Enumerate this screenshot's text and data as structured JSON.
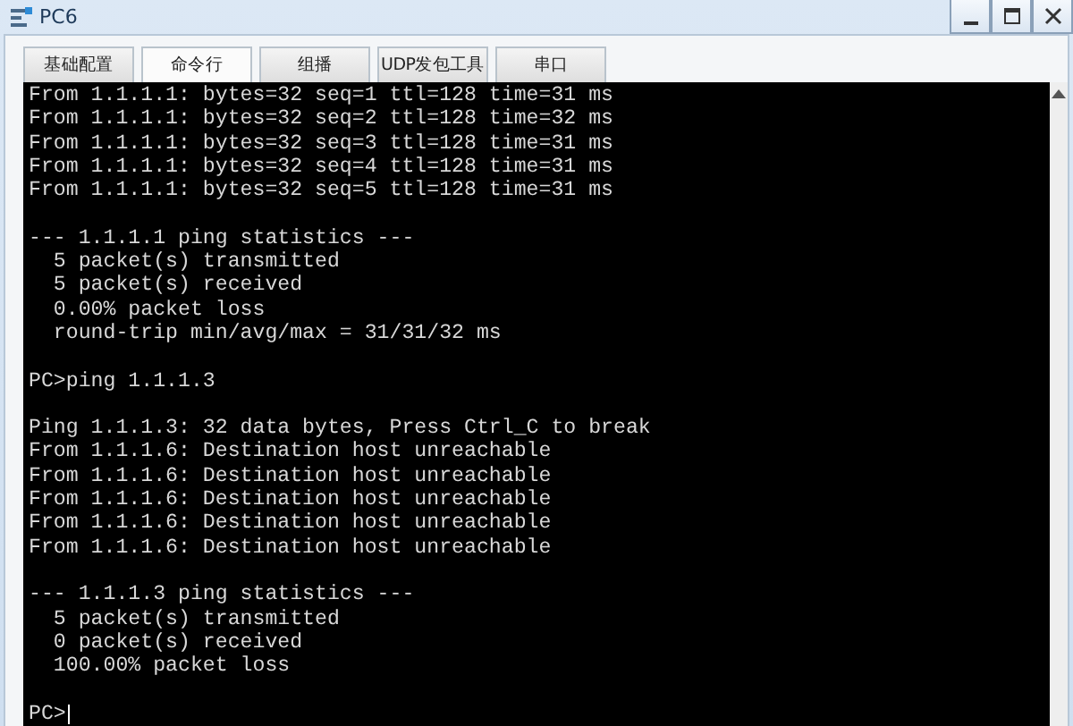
{
  "window": {
    "title": "PC6",
    "controls": [
      {
        "kind": "minimize"
      },
      {
        "kind": "maximize"
      },
      {
        "kind": "close"
      }
    ]
  },
  "tabs": [
    {
      "label": "基础配置",
      "selected": false
    },
    {
      "label": "命令行",
      "selected": true
    },
    {
      "label": "组播",
      "selected": false
    },
    {
      "label": "UDP发包工具",
      "selected": false
    },
    {
      "label": "串口",
      "selected": false
    }
  ],
  "terminal": {
    "blocks": [
      {
        "lines": [
          "From 1.1.1.1: bytes=32 seq=1 ttl=128 time=31 ms",
          "From 1.1.1.1: bytes=32 seq=2 ttl=128 time=32 ms",
          "From 1.1.1.1: bytes=32 seq=3 ttl=128 time=31 ms",
          "From 1.1.1.1: bytes=32 seq=4 ttl=128 time=31 ms",
          "From 1.1.1.1: bytes=32 seq=5 ttl=128 time=31 ms"
        ]
      },
      {
        "lines": [
          "--- 1.1.1.1 ping statistics ---",
          "  5 packet(s) transmitted",
          "  5 packet(s) received",
          "  0.00% packet loss",
          "  round-trip min/avg/max = 31/31/32 ms"
        ]
      },
      {
        "lines": [
          "PC>ping 1.1.1.3"
        ]
      },
      {
        "lines": [
          "Ping 1.1.1.3: 32 data bytes, Press Ctrl_C to break",
          "From 1.1.1.6: Destination host unreachable",
          "From 1.1.1.6: Destination host unreachable",
          "From 1.1.1.6: Destination host unreachable",
          "From 1.1.1.6: Destination host unreachable",
          "From 1.1.1.6: Destination host unreachable"
        ]
      },
      {
        "lines": [
          "--- 1.1.1.3 ping statistics ---",
          "  5 packet(s) transmitted",
          "  0 packet(s) received",
          "  100.00% packet loss"
        ]
      }
    ],
    "prompt": "PC>"
  }
}
